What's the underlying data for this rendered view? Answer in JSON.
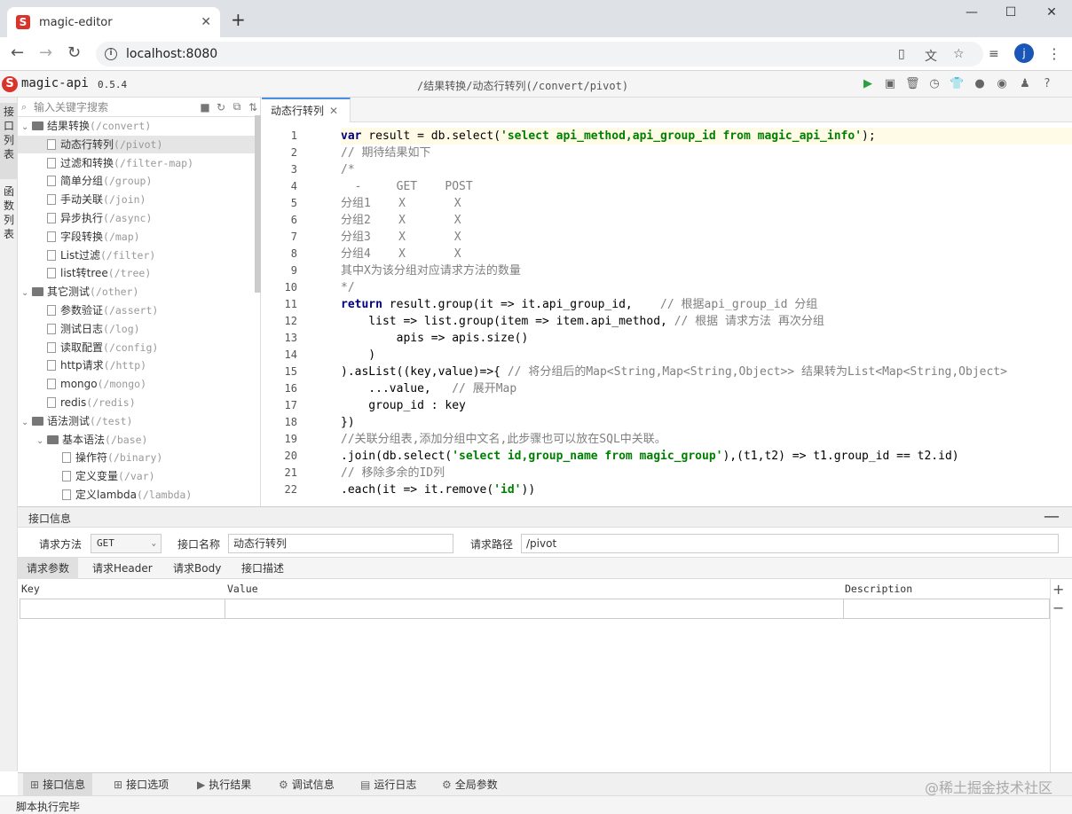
{
  "browser": {
    "tab_title": "magic-editor",
    "url": "localhost:8080",
    "avatar_letter": "j"
  },
  "app": {
    "name": "magic-api",
    "version": "0.5.4",
    "current_path": "/结果转换/动态行转列(/convert/pivot)",
    "accent_color": "#d9342b"
  },
  "side_tabs": [
    "接口列表",
    "函数列表"
  ],
  "tree": {
    "search_placeholder": "输入关键字搜索",
    "nodes": [
      {
        "name": "结果转换",
        "path": "(/convert)",
        "type": "folder",
        "level": 0
      },
      {
        "name": "动态行转列",
        "path": "(/pivot)",
        "type": "file",
        "level": 1,
        "selected": true
      },
      {
        "name": "过滤和转换",
        "path": "(/filter-map)",
        "type": "file",
        "level": 1
      },
      {
        "name": "简单分组",
        "path": "(/group)",
        "type": "file",
        "level": 1
      },
      {
        "name": "手动关联",
        "path": "(/join)",
        "type": "file",
        "level": 1
      },
      {
        "name": "异步执行",
        "path": "(/async)",
        "type": "file",
        "level": 1
      },
      {
        "name": "字段转换",
        "path": "(/map)",
        "type": "file",
        "level": 1
      },
      {
        "name": "List过滤",
        "path": "(/filter)",
        "type": "file",
        "level": 1
      },
      {
        "name": "list转tree",
        "path": "(/tree)",
        "type": "file",
        "level": 1
      },
      {
        "name": "其它测试",
        "path": "(/other)",
        "type": "folder",
        "level": 0
      },
      {
        "name": "参数验证",
        "path": "(/assert)",
        "type": "file",
        "level": 1
      },
      {
        "name": "测试日志",
        "path": "(/log)",
        "type": "file",
        "level": 1
      },
      {
        "name": "读取配置",
        "path": "(/config)",
        "type": "file",
        "level": 1
      },
      {
        "name": "http请求",
        "path": "(/http)",
        "type": "file",
        "level": 1
      },
      {
        "name": "mongo",
        "path": "(/mongo)",
        "type": "file",
        "level": 1
      },
      {
        "name": "redis",
        "path": "(/redis)",
        "type": "file",
        "level": 1
      },
      {
        "name": "语法测试",
        "path": "(/test)",
        "type": "folder",
        "level": 0
      },
      {
        "name": "基本语法",
        "path": "(/base)",
        "type": "folder",
        "level": 1
      },
      {
        "name": "操作符",
        "path": "(/binary)",
        "type": "file",
        "level": 2
      },
      {
        "name": "定义变量",
        "path": "(/var)",
        "type": "file",
        "level": 2
      },
      {
        "name": "定义lambda",
        "path": "(/lambda)",
        "type": "file",
        "level": 2
      }
    ]
  },
  "editor": {
    "tab_label": "动态行转列",
    "lines": [
      "var result = db.select('select api_method,api_group_id from magic_api_info');",
      "// 期待结果如下",
      "/*",
      "  -     GET    POST",
      "分组1    X       X",
      "分组2    X       X",
      "分组3    X       X",
      "分组4    X       X",
      "其中X为该分组对应请求方法的数量",
      "*/",
      "return result.group(it => it.api_group_id,    // 根据api_group_id 分组",
      "    list => list.group(item => item.api_method, // 根据 请求方法 再次分组",
      "        apis => apis.size()",
      "    )",
      ").asList((key,value)=>{ // 将分组后的Map<String,Map<String,Object>> 结果转为List<Map<String,Object>",
      "    ...value,   // 展开Map",
      "    group_id : key",
      "})",
      "//关联分组表,添加分组中文名,此步骤也可以放在SQL中关联。",
      ".join(db.select('select id,group_name from magic_group'),(t1,t2) => t1.group_id == t2.id)",
      "// 移除多余的ID列",
      ".each(it => it.remove('id'))"
    ]
  },
  "info": {
    "header": "接口信息",
    "method_label": "请求方法",
    "method_value": "GET",
    "name_label": "接口名称",
    "name_value": "动态行转列",
    "path_label": "请求路径",
    "path_value": "/pivot",
    "tabs": [
      "请求参数",
      "请求Header",
      "请求Body",
      "接口描述"
    ],
    "columns": [
      "Key",
      "Value",
      "Description"
    ]
  },
  "bottom_tabs": [
    "接口信息",
    "接口选项",
    "执行结果",
    "调试信息",
    "运行日志",
    "全局参数"
  ],
  "watermark": "@稀土掘金技术社区",
  "status_text": "脚本执行完毕"
}
